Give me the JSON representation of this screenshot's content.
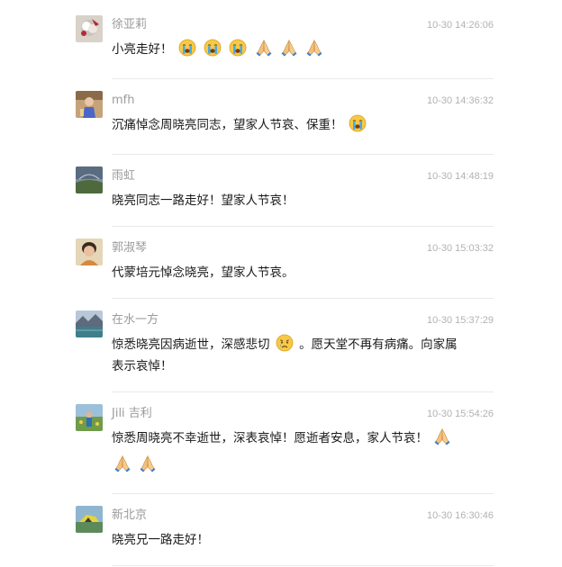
{
  "comments": [
    {
      "name": "徐亚莉",
      "time": "10-30 14:26:06",
      "text": "小亮走好！",
      "emojis": [
        "crying-face-icon",
        "crying-face-icon",
        "crying-face-icon",
        "folded-hands-icon",
        "folded-hands-icon",
        "folded-hands-icon"
      ]
    },
    {
      "name": "mfh",
      "time": "10-30 14:36:32",
      "text": "沉痛悼念周晓亮同志，望家人节哀、保重！",
      "emojis": [
        "crying-face-icon"
      ]
    },
    {
      "name": "雨虹",
      "time": "10-30 14:48:19",
      "text": "晓亮同志一路走好！望家人节哀！"
    },
    {
      "name": "郭淑琴",
      "time": "10-30 15:03:32",
      "text": "代蒙培元悼念晓亮，望家人节哀。"
    },
    {
      "name": "在水一方",
      "time": "10-30 15:37:29",
      "text_part1": "惊悉晓亮因病逝世，深感悲切",
      "text_part2": "。愿天堂不再有病痛。向家属",
      "text_part3": "表示哀悼！",
      "emojis": [
        "sad-tear-face-icon"
      ]
    },
    {
      "name": "Jili  吉利",
      "time": "10-30 15:54:26",
      "text": "惊悉周晓亮不幸逝世，深表哀悼！愿逝者安息，家人节哀！",
      "emojis": [
        "folded-hands-icon",
        "folded-hands-icon",
        "folded-hands-icon"
      ]
    },
    {
      "name": "新北京",
      "time": "10-30 16:30:46",
      "text": "晓亮兄一路走好！"
    }
  ],
  "colors": {
    "name": "#9b9b9b",
    "time": "#b2b2b2",
    "text": "#1a1a1a",
    "divider": "#e9e9e9"
  }
}
